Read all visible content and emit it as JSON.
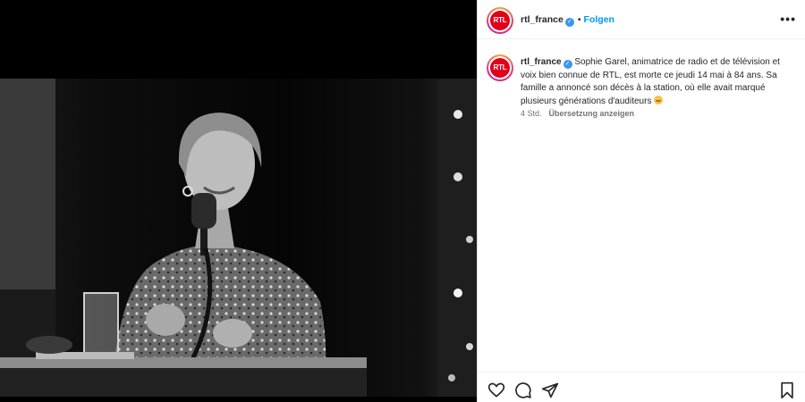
{
  "header": {
    "username": "rtl_france",
    "separator": "•",
    "follow_label": "Folgen",
    "more_icon": "more-horizontal-icon",
    "avatar_text": "RTL"
  },
  "caption": {
    "username": "rtl_france",
    "text": "Sophie Garel, animatrice de radio et de télévision et voix bien connue de RTL, est morte ce jeudi 14 mai à 84 ans. Sa famille a annoncé son décès à la station, où elle avait marqué plusieurs générations d'auditeurs",
    "emoji": "crying-face-emoji",
    "time": "4 Std.",
    "translate_label": "Übersetzung anzeigen"
  },
  "actions": {
    "icons": [
      "heart-icon",
      "comment-icon",
      "share-icon",
      "bookmark-icon"
    ]
  },
  "colors": {
    "brand_red": "#e2001a",
    "link_blue": "#0095f6",
    "verified_blue": "#3897f0"
  }
}
